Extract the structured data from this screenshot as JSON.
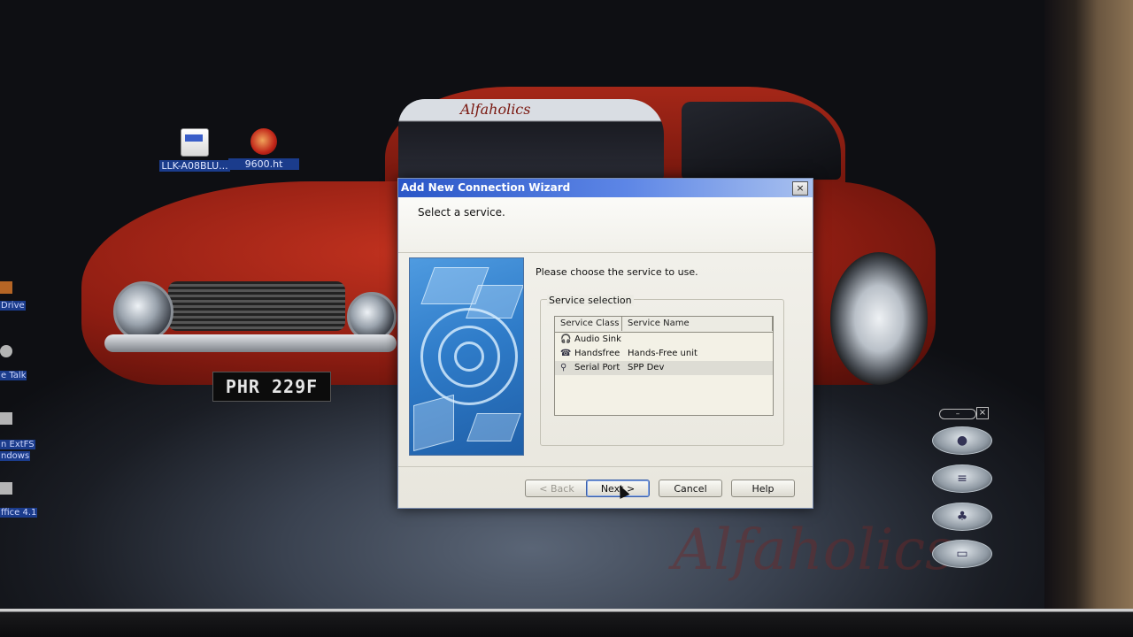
{
  "desktop": {
    "icons": [
      {
        "label": "LLK-A08BLU...",
        "icon": "document-icon"
      },
      {
        "label": "9600.ht",
        "icon": "hyperterminal-icon"
      }
    ],
    "edge_labels": [
      "Drive",
      "e Talk",
      "n ExtFS",
      "ndows",
      "ffice 4.1"
    ],
    "watermark": "Alfaholics",
    "license_plate": "PHR 229F",
    "windshield_text": "Alfaholics"
  },
  "dialog": {
    "title": "Add New Connection Wizard",
    "close_label": "×",
    "header": "Select a service.",
    "instruction": "Please choose the service to use.",
    "group_label": "Service selection",
    "columns": [
      "Service Class",
      "Service Name"
    ],
    "rows": [
      {
        "class": "Audio Sink",
        "name": "",
        "icon": "headphones-icon"
      },
      {
        "class": "Handsfree",
        "name": "Hands-Free unit",
        "icon": "headset-icon"
      },
      {
        "class": "Serial Port",
        "name": "SPP Dev",
        "icon": "serial-port-icon",
        "selected": true
      }
    ],
    "buttons": {
      "back": "< Back",
      "next": "Next >",
      "cancel": "Cancel",
      "help": "Help"
    }
  }
}
